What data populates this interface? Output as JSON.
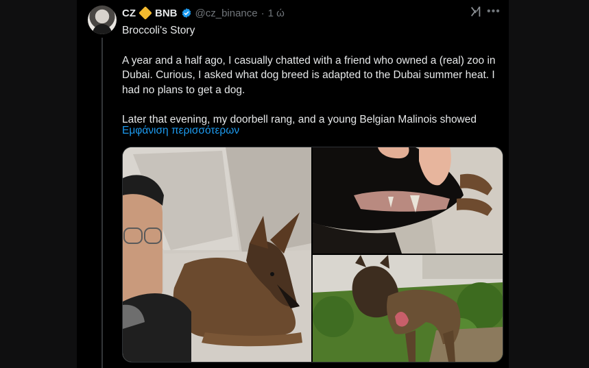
{
  "tweet": {
    "author_name": "CZ",
    "badge_text": "BNB",
    "handle": "@cz_binance",
    "separator": "·",
    "time": "1 ώ",
    "paragraphs": [
      "Broccoli's Story",
      "A year and a half ago, I casually chatted with a friend who owned a (real) zoo in Dubai. Curious, I asked what dog breed is adapted to the Dubai summer heat. I had no plans to get a dog.",
      "Later that evening, my doorbell rang, and a young Belgian Malinois showed"
    ],
    "show_more": "Εμφάνιση περισσότερων"
  },
  "icons": {
    "verified": "verified-badge-icon",
    "grok": "grok-icon",
    "more": "more-icon"
  },
  "colors": {
    "background": "#000000",
    "text": "#e7e9ea",
    "muted": "#71767b",
    "link": "#1d9bf0",
    "bnb": "#f3ba2f"
  }
}
